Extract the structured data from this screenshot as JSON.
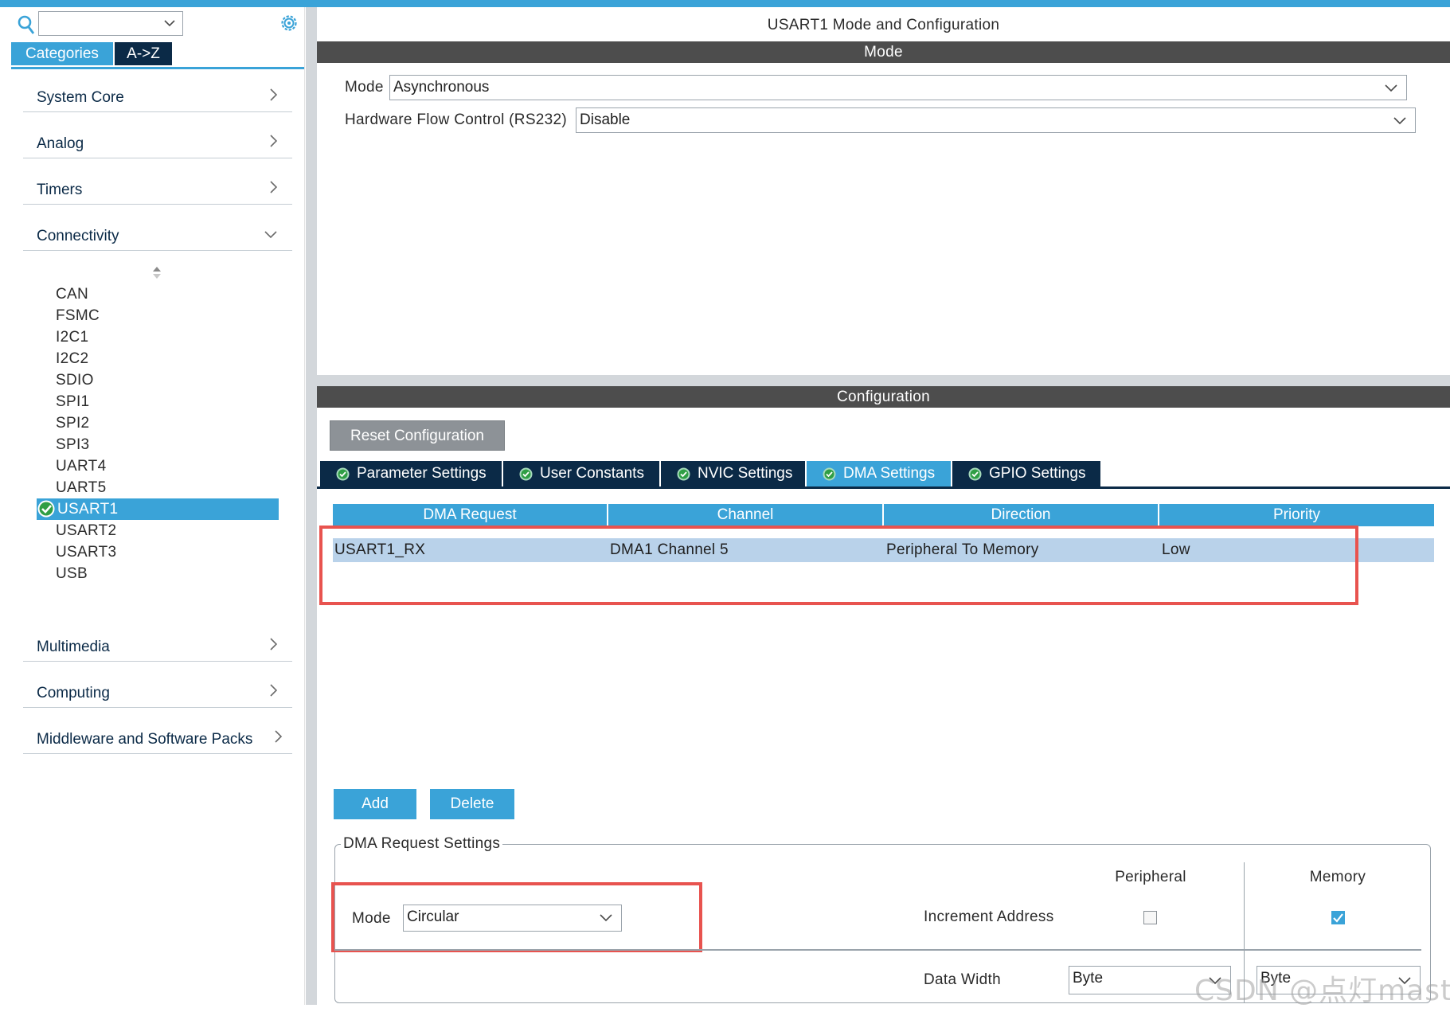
{
  "colors": {
    "accent": "#3aa3d8",
    "dark_navy": "#0b2a47",
    "header_gray": "#4d4d4d",
    "selected_row": "#b9d2ea",
    "highlight_red": "#e8534f",
    "ok_green": "#2f9e44"
  },
  "left_panel": {
    "search": {
      "value": "",
      "placeholder": ""
    },
    "tabs": [
      "Categories",
      "A->Z"
    ],
    "categories": [
      {
        "label": "System Core",
        "expanded": false
      },
      {
        "label": "Analog",
        "expanded": false
      },
      {
        "label": "Timers",
        "expanded": false
      },
      {
        "label": "Connectivity",
        "expanded": true
      },
      {
        "label": "Multimedia",
        "expanded": false
      },
      {
        "label": "Computing",
        "expanded": false
      },
      {
        "label": "Middleware and Software Packs",
        "expanded": false
      }
    ],
    "connectivity_items": [
      "CAN",
      "FSMC",
      "I2C1",
      "I2C2",
      "SDIO",
      "SPI1",
      "SPI2",
      "SPI3",
      "UART4",
      "UART5",
      "USART1",
      "USART2",
      "USART3",
      "USB"
    ],
    "selected_item": "USART1"
  },
  "right_panel": {
    "title": "USART1 Mode and Configuration",
    "mode_header": "Mode",
    "mode": {
      "mode_label": "Mode",
      "mode_value": "Asynchronous",
      "flow_label": "Hardware Flow Control (RS232)",
      "flow_value": "Disable"
    },
    "config_header": "Configuration",
    "reset_button": "Reset Configuration",
    "tabs": [
      {
        "label": "Parameter Settings",
        "active": false
      },
      {
        "label": "User Constants",
        "active": false
      },
      {
        "label": "NVIC Settings",
        "active": false
      },
      {
        "label": "DMA Settings",
        "active": true
      },
      {
        "label": "GPIO Settings",
        "active": false
      }
    ],
    "dma_table": {
      "columns": [
        "DMA Request",
        "Channel",
        "Direction",
        "Priority"
      ],
      "rows": [
        [
          "USART1_RX",
          "DMA1 Channel 5",
          "Peripheral To Memory",
          "Low"
        ]
      ]
    },
    "add_button": "Add",
    "delete_button": "Delete",
    "dma_request_settings": {
      "legend": "DMA Request Settings",
      "peripheral_header": "Peripheral",
      "memory_header": "Memory",
      "mode_label": "Mode",
      "mode_value": "Circular",
      "increment_label": "Increment Address",
      "increment_peripheral": false,
      "increment_memory": true,
      "data_width_label": "Data Width",
      "data_width_peripheral": "Byte",
      "data_width_memory": "Byte"
    }
  },
  "watermark": "CSDN @点灯master"
}
